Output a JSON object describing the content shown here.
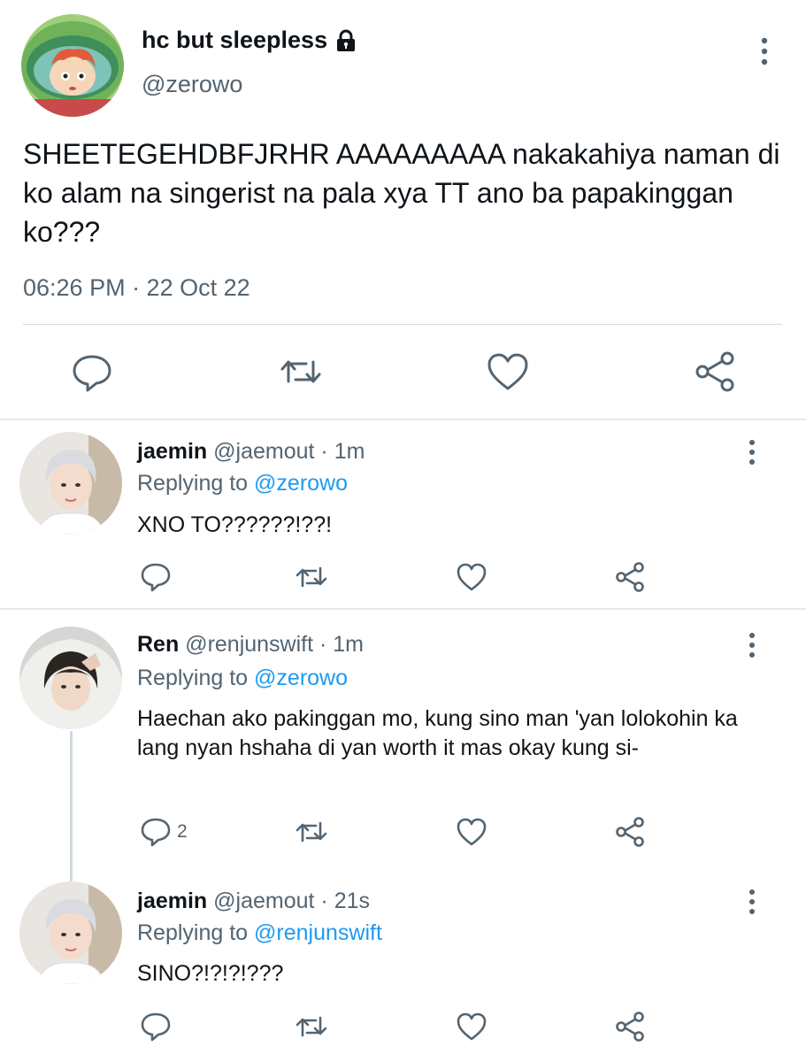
{
  "main_tweet": {
    "display_name": "hc but sleepless",
    "handle": "@zerowo",
    "text": "SHEETEGEHDBFJRHR AAAAAAAAA nakakahiya naman di ko alam na singerist na pala xya TT ano ba papakinggan ko???",
    "timestamp": "06:26 PM · 22 Oct 22",
    "icons": [
      "lock-icon",
      "more-icon",
      "reply-icon",
      "retweet-icon",
      "like-icon",
      "share-icon"
    ]
  },
  "replies": [
    {
      "display_name": "jaemin",
      "meta": "@jaemout · 1m",
      "replying_prefix": "Replying to ",
      "replying_to": "@zerowo",
      "text": "XNO TO??????!??!",
      "reply_count": ""
    },
    {
      "display_name": "Ren",
      "meta": "@renjunswift · 1m",
      "replying_prefix": "Replying to ",
      "replying_to": "@zerowo",
      "text": "Haechan ako pakinggan mo, kung sino man 'yan lolokohin ka lang nyan hshaha di yan worth it mas okay kung si-",
      "reply_count": "2"
    },
    {
      "display_name": "jaemin",
      "meta": "@jaemout · 21s",
      "replying_prefix": "Replying to ",
      "replying_to": "@renjunswift",
      "text": "SINO?!?!?!???",
      "reply_count": ""
    }
  ],
  "colors": {
    "text": "#0f1419",
    "secondary": "#536471",
    "link": "#1d9bf0"
  }
}
